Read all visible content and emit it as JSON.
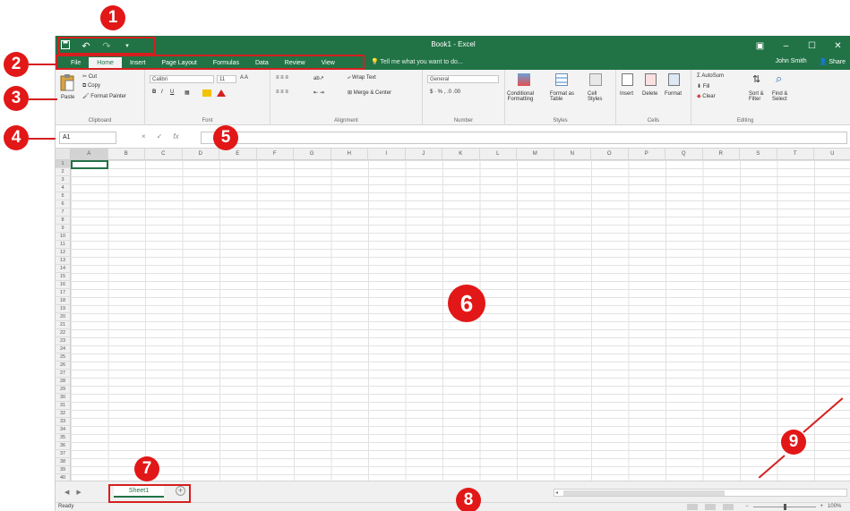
{
  "window": {
    "title": "Book1 - Excel",
    "accent": "#217346"
  },
  "qat": {
    "save_icon": "save-icon",
    "undo_icon": "undo-icon",
    "redo_icon": "redo-icon",
    "customize_icon": "chevron-down-icon"
  },
  "tabs": [
    {
      "label": "File"
    },
    {
      "label": "Home",
      "active": true
    },
    {
      "label": "Insert"
    },
    {
      "label": "Page Layout"
    },
    {
      "label": "Formulas"
    },
    {
      "label": "Data"
    },
    {
      "label": "Review"
    },
    {
      "label": "View"
    }
  ],
  "tell_me": "Tell me what you want to do...",
  "user": {
    "name": "John Smith",
    "share": "Share"
  },
  "ribbon": {
    "clipboard": {
      "label": "Clipboard",
      "paste": "Paste",
      "cut": "Cut",
      "copy": "Copy",
      "format_painter": "Format Painter"
    },
    "font": {
      "label": "Font",
      "name": "Calibri",
      "size": "11"
    },
    "alignment": {
      "label": "Alignment",
      "wrap_text": "Wrap Text",
      "merge_center": "Merge & Center"
    },
    "number": {
      "label": "Number",
      "format": "General"
    },
    "styles": {
      "label": "Styles",
      "conditional": [
        "Conditional",
        "Formatting"
      ],
      "format_table": [
        "Format as",
        "Table"
      ],
      "cell_styles": [
        "Cell",
        "Styles"
      ]
    },
    "cells": {
      "label": "Cells",
      "insert": "Insert",
      "delete": "Delete",
      "format": "Format"
    },
    "editing": {
      "label": "Editing",
      "autosum": "AutoSum",
      "fill": "Fill",
      "clear": "Clear",
      "sort": [
        "Sort &",
        "Filter"
      ],
      "find": [
        "Find &",
        "Select"
      ]
    }
  },
  "formula_bar": {
    "name_box": "A1",
    "cancel": "×",
    "enter": "✓",
    "fx": "fx",
    "value": ""
  },
  "columns": [
    "A",
    "B",
    "C",
    "D",
    "E",
    "F",
    "G",
    "H",
    "I",
    "J",
    "K",
    "L",
    "M",
    "N",
    "O",
    "P",
    "Q",
    "R",
    "S",
    "T",
    "U"
  ],
  "rows": [
    "1",
    "2",
    "3",
    "4",
    "5",
    "6",
    "7",
    "8",
    "9",
    "10",
    "11",
    "12",
    "13",
    "14",
    "15",
    "16",
    "17",
    "18",
    "19",
    "20",
    "21",
    "22",
    "23",
    "24",
    "25",
    "26",
    "27",
    "28",
    "29",
    "30",
    "31",
    "32",
    "33",
    "34",
    "35",
    "36",
    "37",
    "38",
    "39",
    "40"
  ],
  "sheet": {
    "tab": "Sheet1",
    "add": "+"
  },
  "status": {
    "ready": "Ready",
    "zoom": "100%"
  },
  "callouts": [
    "1",
    "2",
    "3",
    "4",
    "5",
    "6",
    "7",
    "8",
    "9"
  ]
}
